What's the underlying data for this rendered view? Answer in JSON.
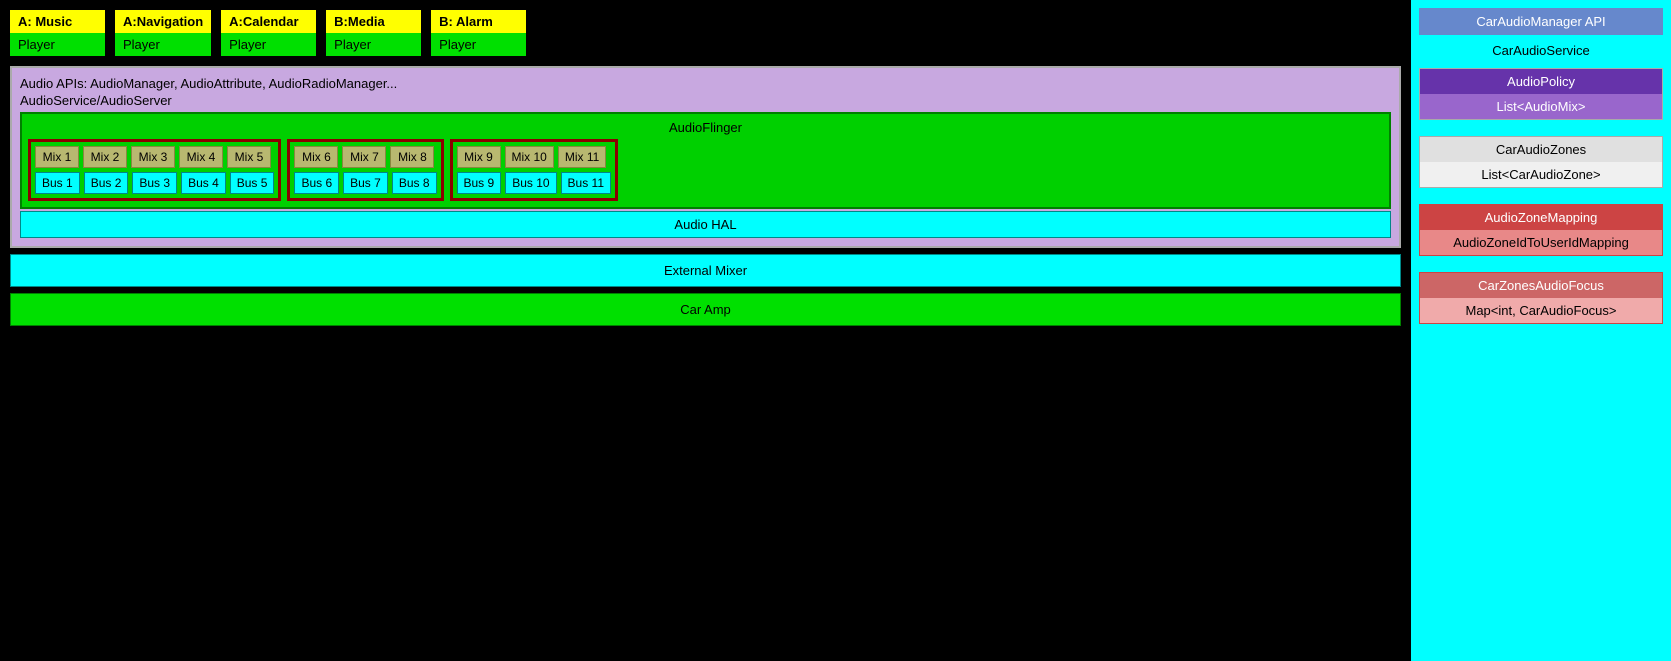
{
  "players": [
    {
      "label": "A: Music",
      "sublabel": "Player"
    },
    {
      "label": "A:Navigation",
      "sublabel": "Player"
    },
    {
      "label": "A:Calendar",
      "sublabel": "Player"
    },
    {
      "label": "B:Media",
      "sublabel": "Player"
    },
    {
      "label": "B: Alarm",
      "sublabel": "Player"
    }
  ],
  "diagram": {
    "audio_apis": "Audio APIs: AudioManager, AudioAttribute, AudioRadioManager...",
    "audio_service": "AudioService/AudioServer",
    "audio_flinger": "AudioFlinger",
    "audio_hal": "Audio HAL",
    "external_mixer": "External Mixer",
    "car_amp": "Car Amp"
  },
  "mixes": {
    "zone1": [
      "Mix 1",
      "Mix 2",
      "Mix 3",
      "Mix 4",
      "Mix 5"
    ],
    "zone2": [
      "Mix 6",
      "Mix 7",
      "Mix 8"
    ],
    "zone3": [
      "Mix 9",
      "Mix 10",
      "Mix 11"
    ]
  },
  "buses": {
    "zone1": [
      "Bus 1",
      "Bus 2",
      "Bus 3",
      "Bus 4",
      "Bus 5"
    ],
    "zone2": [
      "Bus 6",
      "Bus 7",
      "Bus 8"
    ],
    "zone3": [
      "Bus 9",
      "Bus 10",
      "Bus 11"
    ]
  },
  "right_panel": {
    "title": "CarAudioManager API",
    "car_audio_service": "CarAudioService",
    "audio_policy": "AudioPolicy",
    "list_audio_mix": "List<AudioMix>",
    "car_audio_zones": "CarAudioZones",
    "list_car_audio_zone": "List<CarAudioZone>",
    "audio_zone_mapping": "AudioZoneMapping",
    "audio_zone_id_mapping": "AudioZoneIdToUserIdMapping",
    "car_zones_audio_focus": "CarZonesAudioFocus",
    "map_car_audio_focus": "Map<int, CarAudioFocus>"
  }
}
